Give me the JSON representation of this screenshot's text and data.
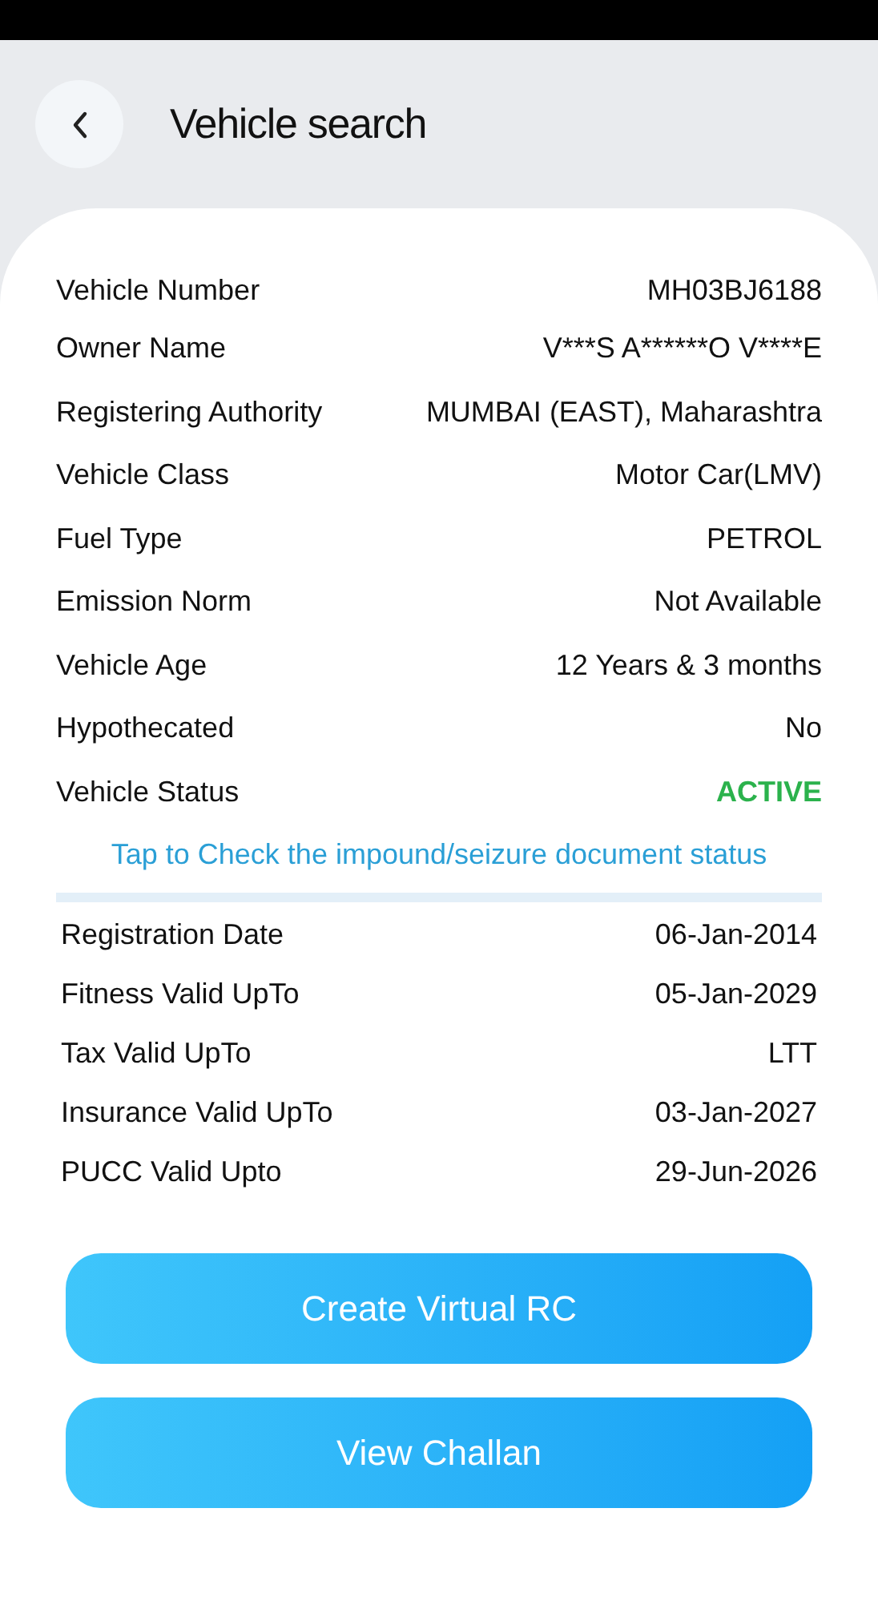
{
  "header": {
    "title": "Vehicle search"
  },
  "details": [
    {
      "label": "Vehicle Number",
      "value": "MH03BJ6188",
      "kind": "text"
    },
    {
      "label": "Owner Name",
      "value": "V***S A******O V****E",
      "kind": "text"
    },
    {
      "label": "Registering Authority",
      "value": "MUMBAI (EAST), Maharashtra",
      "kind": "text"
    },
    {
      "label": "Vehicle Class",
      "value": "Motor Car(LMV)",
      "kind": "text"
    },
    {
      "label": "Fuel Type",
      "value": "PETROL",
      "kind": "text"
    },
    {
      "label": "Emission Norm",
      "value": "Not Available",
      "kind": "text"
    },
    {
      "label": "Vehicle Age",
      "value": "12 Years  & 3 months",
      "kind": "text"
    },
    {
      "label": "Hypothecated",
      "value": "No",
      "kind": "text"
    },
    {
      "label": "Vehicle Status",
      "value": "ACTIVE",
      "kind": "status"
    }
  ],
  "impound_link": "Tap to Check the impound/seizure document status",
  "validity": [
    {
      "label": "Registration Date",
      "value": "06-Jan-2014"
    },
    {
      "label": "Fitness Valid UpTo",
      "value": "05-Jan-2029"
    },
    {
      "label": "Tax Valid UpTo",
      "value": "LTT"
    },
    {
      "label": "Insurance Valid UpTo",
      "value": "03-Jan-2027"
    },
    {
      "label": "PUCC Valid Upto",
      "value": "29-Jun-2026"
    }
  ],
  "buttons": [
    "Create Virtual RC",
    "View Challan"
  ]
}
